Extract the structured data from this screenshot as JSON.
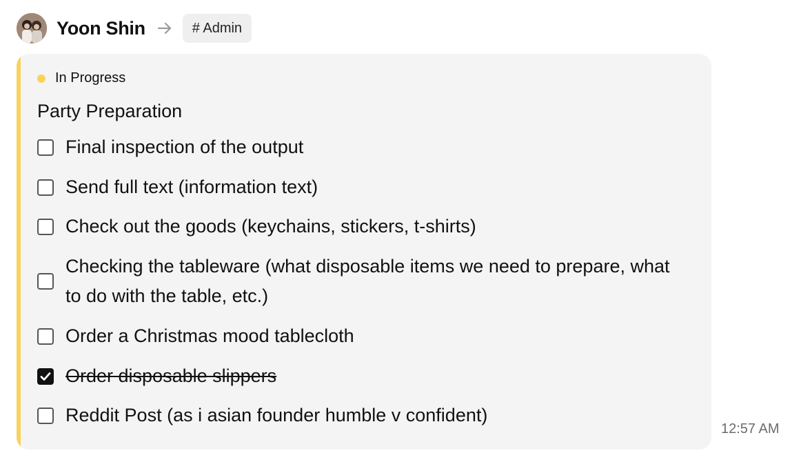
{
  "message": {
    "author": "Yoon Shin",
    "channel": "# Admin",
    "timestamp": "12:57 AM"
  },
  "card": {
    "status_label": "In Progress",
    "status_color": "#f8d35a",
    "accent_color": "#f8d35a",
    "title": "Party Preparation",
    "tasks": [
      {
        "label": "Final inspection of the output",
        "checked": false
      },
      {
        "label": "Send full text (information text)",
        "checked": false
      },
      {
        "label": "Check out the goods (keychains, stickers, t-shirts)",
        "checked": false
      },
      {
        "label": "Checking the tableware (what disposable items we need to prepare, what to do with the table, etc.)",
        "checked": false
      },
      {
        "label": "Order a Christmas mood tablecloth",
        "checked": false
      },
      {
        "label": "Order disposable slippers",
        "checked": true
      },
      {
        "label": "Reddit Post (as i asian founder humble v confident)",
        "checked": false
      }
    ]
  },
  "icons": {
    "arrow": "arrow-right-icon",
    "check": "checkmark-icon",
    "status": "status-dot-icon"
  }
}
